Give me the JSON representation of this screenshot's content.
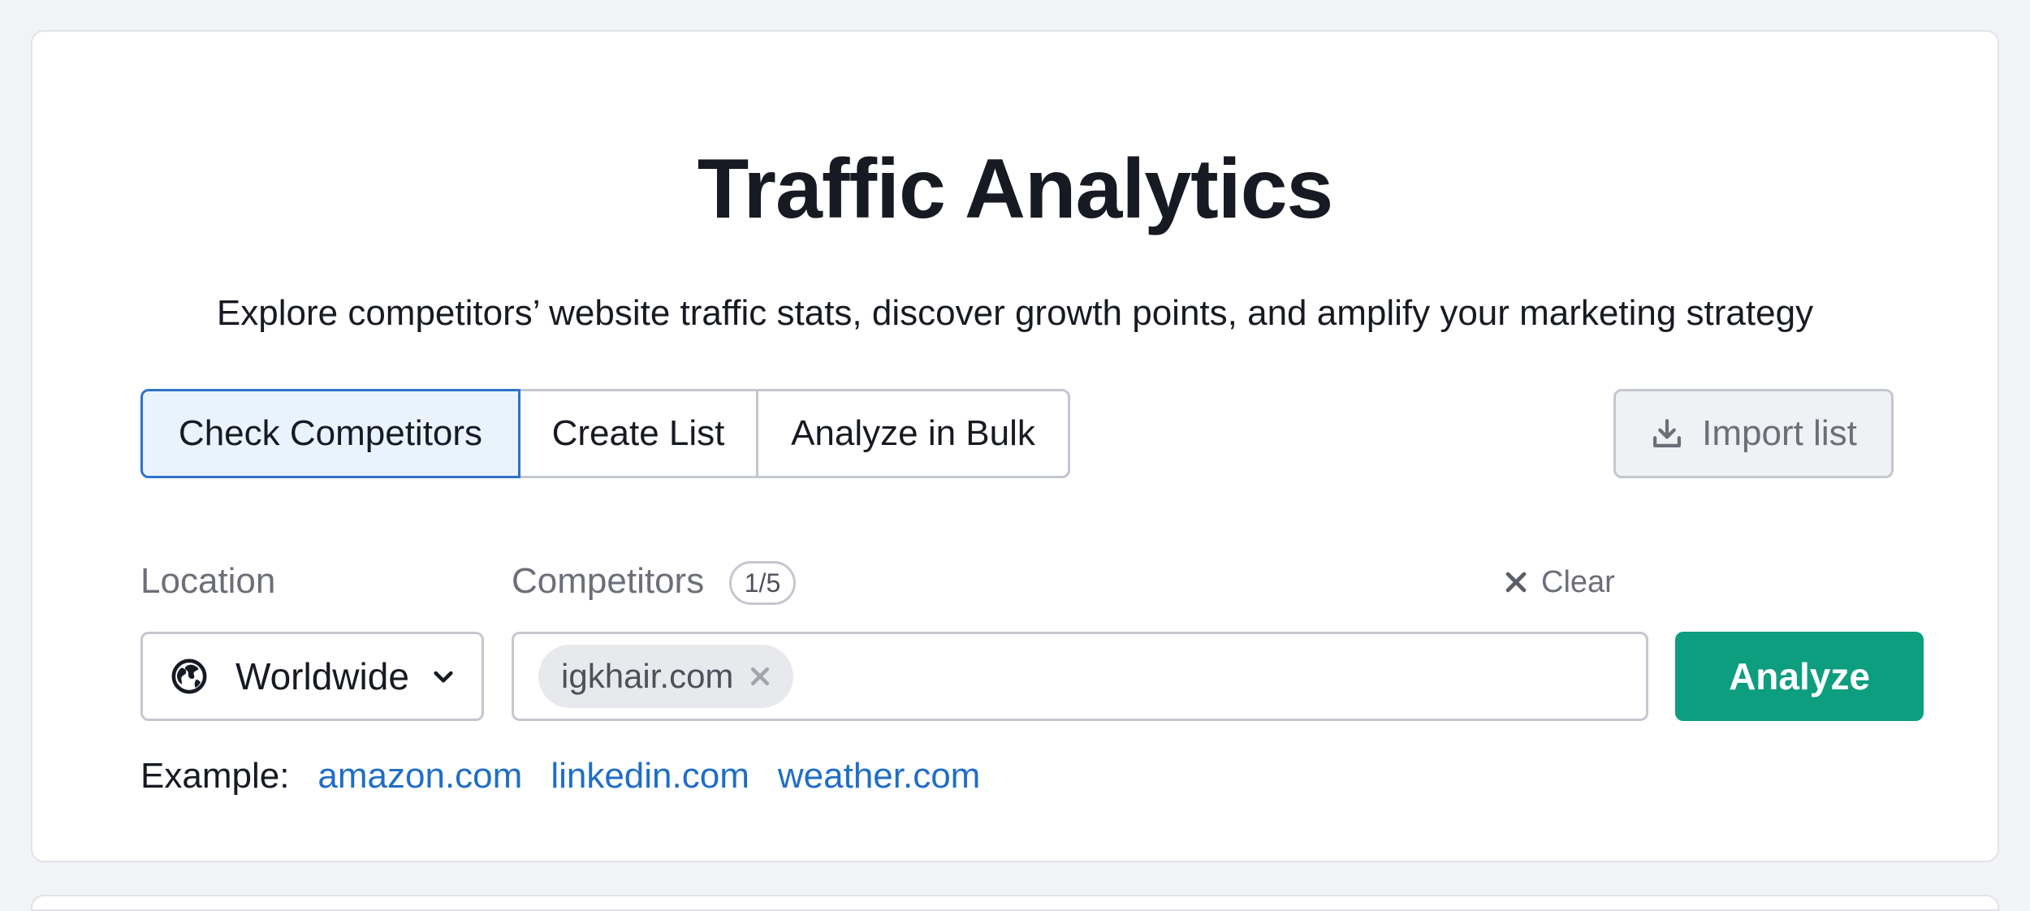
{
  "header": {
    "title": "Traffic Analytics",
    "subtitle": "Explore competitors’ website traffic stats, discover growth points, and amplify your marketing strategy"
  },
  "tabs": [
    {
      "label": "Check Competitors",
      "active": true
    },
    {
      "label": "Create List",
      "active": false
    },
    {
      "label": "Analyze in Bulk",
      "active": false
    }
  ],
  "import_button": {
    "label": "Import list",
    "icon": "download-icon"
  },
  "location": {
    "label": "Location",
    "value": "Worldwide",
    "icon": "globe-icon"
  },
  "competitors": {
    "label": "Competitors",
    "count": "1/5",
    "chips": [
      "igkhair.com"
    ],
    "clear_label": "Clear"
  },
  "analyze_button": {
    "label": "Analyze"
  },
  "examples": {
    "label": "Example:",
    "links": [
      "amazon.com",
      "linkedin.com",
      "weather.com"
    ]
  },
  "colors": {
    "accent_blue": "#2f73c8",
    "active_tab_bg": "#e9f3fe",
    "analyze_green": "#0c9e7e",
    "link_blue": "#1f6ec8"
  }
}
